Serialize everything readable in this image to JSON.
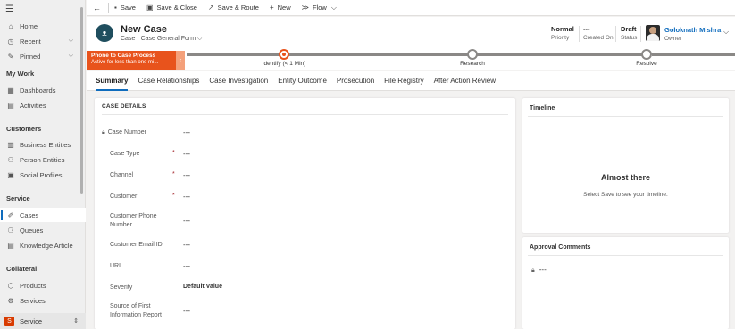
{
  "sidebar": {
    "menu_icon": "hamburger-icon",
    "top_items": [
      {
        "label": "Home",
        "icon": "home-icon"
      },
      {
        "label": "Recent",
        "icon": "clock-icon"
      },
      {
        "label": "Pinned",
        "icon": "pin-icon"
      }
    ],
    "groups": [
      {
        "title": "My Work",
        "items": [
          {
            "label": "Dashboards"
          },
          {
            "label": "Activities"
          }
        ]
      },
      {
        "title": "Customers",
        "items": [
          {
            "label": "Business Entities"
          },
          {
            "label": "Person Entities"
          },
          {
            "label": "Social Profiles"
          }
        ]
      },
      {
        "title": "Service",
        "items": [
          {
            "label": "Cases"
          },
          {
            "label": "Queues"
          },
          {
            "label": "Knowledge Article"
          }
        ]
      },
      {
        "title": "Collateral",
        "items": [
          {
            "label": "Products"
          },
          {
            "label": "Services"
          }
        ]
      }
    ],
    "active_item": "Cases",
    "area": {
      "badge": "S",
      "label": "Service"
    }
  },
  "commandbar": {
    "back_icon": "back-arrow-icon",
    "save": "Save",
    "save_close": "Save & Close",
    "save_route": "Save & Route",
    "new": "New",
    "flow": "Flow"
  },
  "header": {
    "avatar_icon": "case-icon",
    "title": "New Case",
    "entity": "Case",
    "form": "Case General Form",
    "priority": {
      "value": "Normal",
      "label": "Priority"
    },
    "created_on": {
      "value": "---",
      "label": "Created On"
    },
    "status": {
      "value": "Draft",
      "label": "Status"
    },
    "owner": {
      "name": "Goloknath Mishra",
      "label": "Owner"
    }
  },
  "bpf": {
    "process_name": "Phone to Case Process",
    "process_sub": "Active for less than one mi...",
    "stages": [
      "Identify  (< 1 Min)",
      "Research",
      "Resolve"
    ],
    "active_stage": 0,
    "accent": "#e8531c"
  },
  "tabs": [
    "Summary",
    "Case Relationships",
    "Case Investigation",
    "Entity Outcome",
    "Prosecution",
    "File Registry",
    "After Action Review"
  ],
  "active_tab": "Summary",
  "case_details": {
    "title": "CASE DETAILS",
    "fields": {
      "case_number": {
        "label": "Case Number",
        "value": "---"
      },
      "case_type": {
        "label": "Case Type",
        "value": "---"
      },
      "channel": {
        "label": "Channel",
        "value": "---"
      },
      "customer": {
        "label": "Customer",
        "value": "---"
      },
      "customer_phone": {
        "label": "Customer Phone Number",
        "value": "---"
      },
      "customer_email": {
        "label": "Customer Email ID",
        "value": "---"
      },
      "url": {
        "label": "URL",
        "value": "---"
      },
      "severity": {
        "label": "Severity",
        "value": "Default Value"
      },
      "source": {
        "label": "Source of First Information Report",
        "value": "---"
      }
    },
    "required_mark": "*"
  },
  "timeline": {
    "title": "Timeline",
    "heading": "Almost there",
    "message": "Select Save to see your timeline."
  },
  "approval": {
    "title": "Approval Comments",
    "value": "---"
  }
}
